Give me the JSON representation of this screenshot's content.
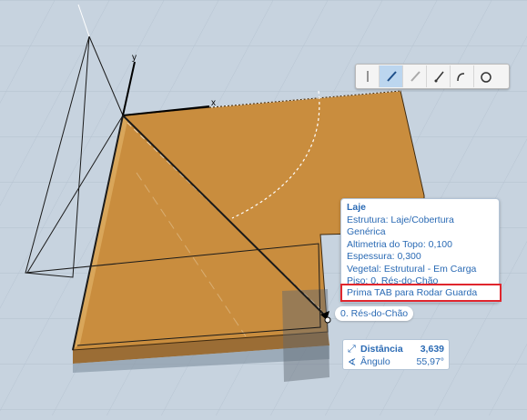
{
  "viewport": {
    "axis_x_label": "x",
    "axis_y_label": "y",
    "slab_color": "#c98d3e",
    "background_color": "#c7d3df"
  },
  "toolbar": {
    "buttons": [
      {
        "icon": "line-cursor-icon",
        "active": false
      },
      {
        "icon": "pencil-icon",
        "active": true
      },
      {
        "icon": "pencil-disabled-icon",
        "active": false
      },
      {
        "icon": "pencil-node-icon",
        "active": false
      },
      {
        "icon": "pencil-arc-icon",
        "active": false
      },
      {
        "icon": "pencil-rotate-icon",
        "active": false
      }
    ]
  },
  "tooltip": {
    "title": "Laje",
    "lines": [
      "Estrutura: Laje/Cobertura Genérica",
      "Altimetria do Topo: 0,100",
      "Espessura: 0,300",
      "Vegetal: Estrutural - Em Carga",
      "Piso: 0. Rés-do-Chão"
    ],
    "hint": "Prima TAB para Rodar Guarda"
  },
  "floor_tag": "0. Rés-do-Chão",
  "tracker": {
    "distance_label": "Distância",
    "distance_value": "3,639",
    "angle_label": "Ângulo",
    "angle_value": "55,97°"
  },
  "colors": {
    "accent": "#2a6ab4",
    "highlight_border": "#e0262d"
  }
}
